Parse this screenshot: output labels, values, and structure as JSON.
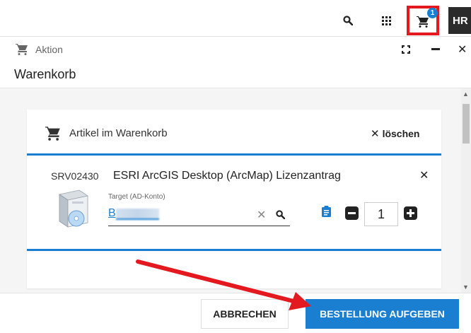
{
  "header": {
    "cart_badge_count": "1",
    "user_initials": "HR"
  },
  "window": {
    "action_label": "Aktion",
    "title": "Warenkorb"
  },
  "cart": {
    "heading": "Artikel im Warenkorb",
    "delete_all_label": "löschen",
    "item": {
      "sku": "SRV02430",
      "name": "ESRI ArcGIS Desktop (ArcMap) Lizenzantrag",
      "target_label": "Target (AD-Konto)",
      "target_value_first_char": "B",
      "quantity": "1"
    }
  },
  "actions": {
    "cancel_label": "ABBRECHEN",
    "order_label": "BESTELLUNG AUFGEBEN"
  },
  "colors": {
    "accent": "#1a7fd0",
    "highlight": "#e3191f"
  }
}
